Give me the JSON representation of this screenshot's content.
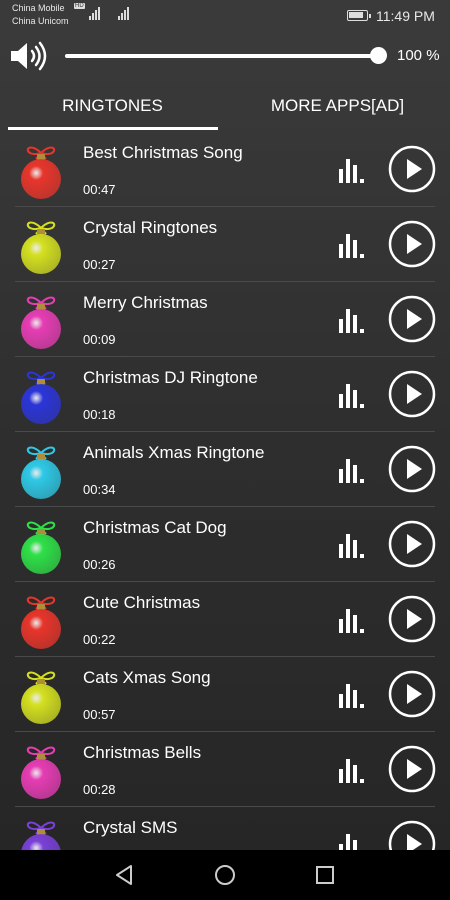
{
  "status_bar": {
    "carrier_1": "China Mobile",
    "carrier_1_badge": "HD",
    "carrier_2": "China Unicom",
    "time": "11:49 PM"
  },
  "volume": {
    "value_text": "100 %",
    "level": 1.0,
    "icon": "speaker-icon"
  },
  "tabs": [
    {
      "label": "RINGTONES",
      "selected": true
    },
    {
      "label": "MORE APPS[AD]",
      "selected": false
    }
  ],
  "ringtones": [
    {
      "title": "Best Christmas Song",
      "duration": "00:47",
      "color": "#e8352b"
    },
    {
      "title": "Crystal Ringtones",
      "duration": "00:27",
      "color": "#d4e020"
    },
    {
      "title": "Merry Christmas",
      "duration": "00:09",
      "color": "#e63db4"
    },
    {
      "title": "Christmas DJ Ringtone",
      "duration": "00:18",
      "color": "#2b35d8"
    },
    {
      "title": "Animals Xmas Ringtone",
      "duration": "00:34",
      "color": "#2ec9e6"
    },
    {
      "title": "Christmas Cat Dog",
      "duration": "00:26",
      "color": "#2ee048"
    },
    {
      "title": "Cute Christmas",
      "duration": "00:22",
      "color": "#e8352b"
    },
    {
      "title": "Cats Xmas Song",
      "duration": "00:57",
      "color": "#d4e020"
    },
    {
      "title": "Christmas Bells",
      "duration": "00:28",
      "color": "#e63db4"
    },
    {
      "title": "Crystal SMS",
      "duration": "",
      "color": "#7a40d8"
    }
  ],
  "colors": {
    "background": "#2e2e2e",
    "accent": "#ffffff",
    "nav_bar": "#000000"
  },
  "nav": {
    "icons": [
      "back-icon",
      "home-icon",
      "recent-apps-icon"
    ]
  }
}
